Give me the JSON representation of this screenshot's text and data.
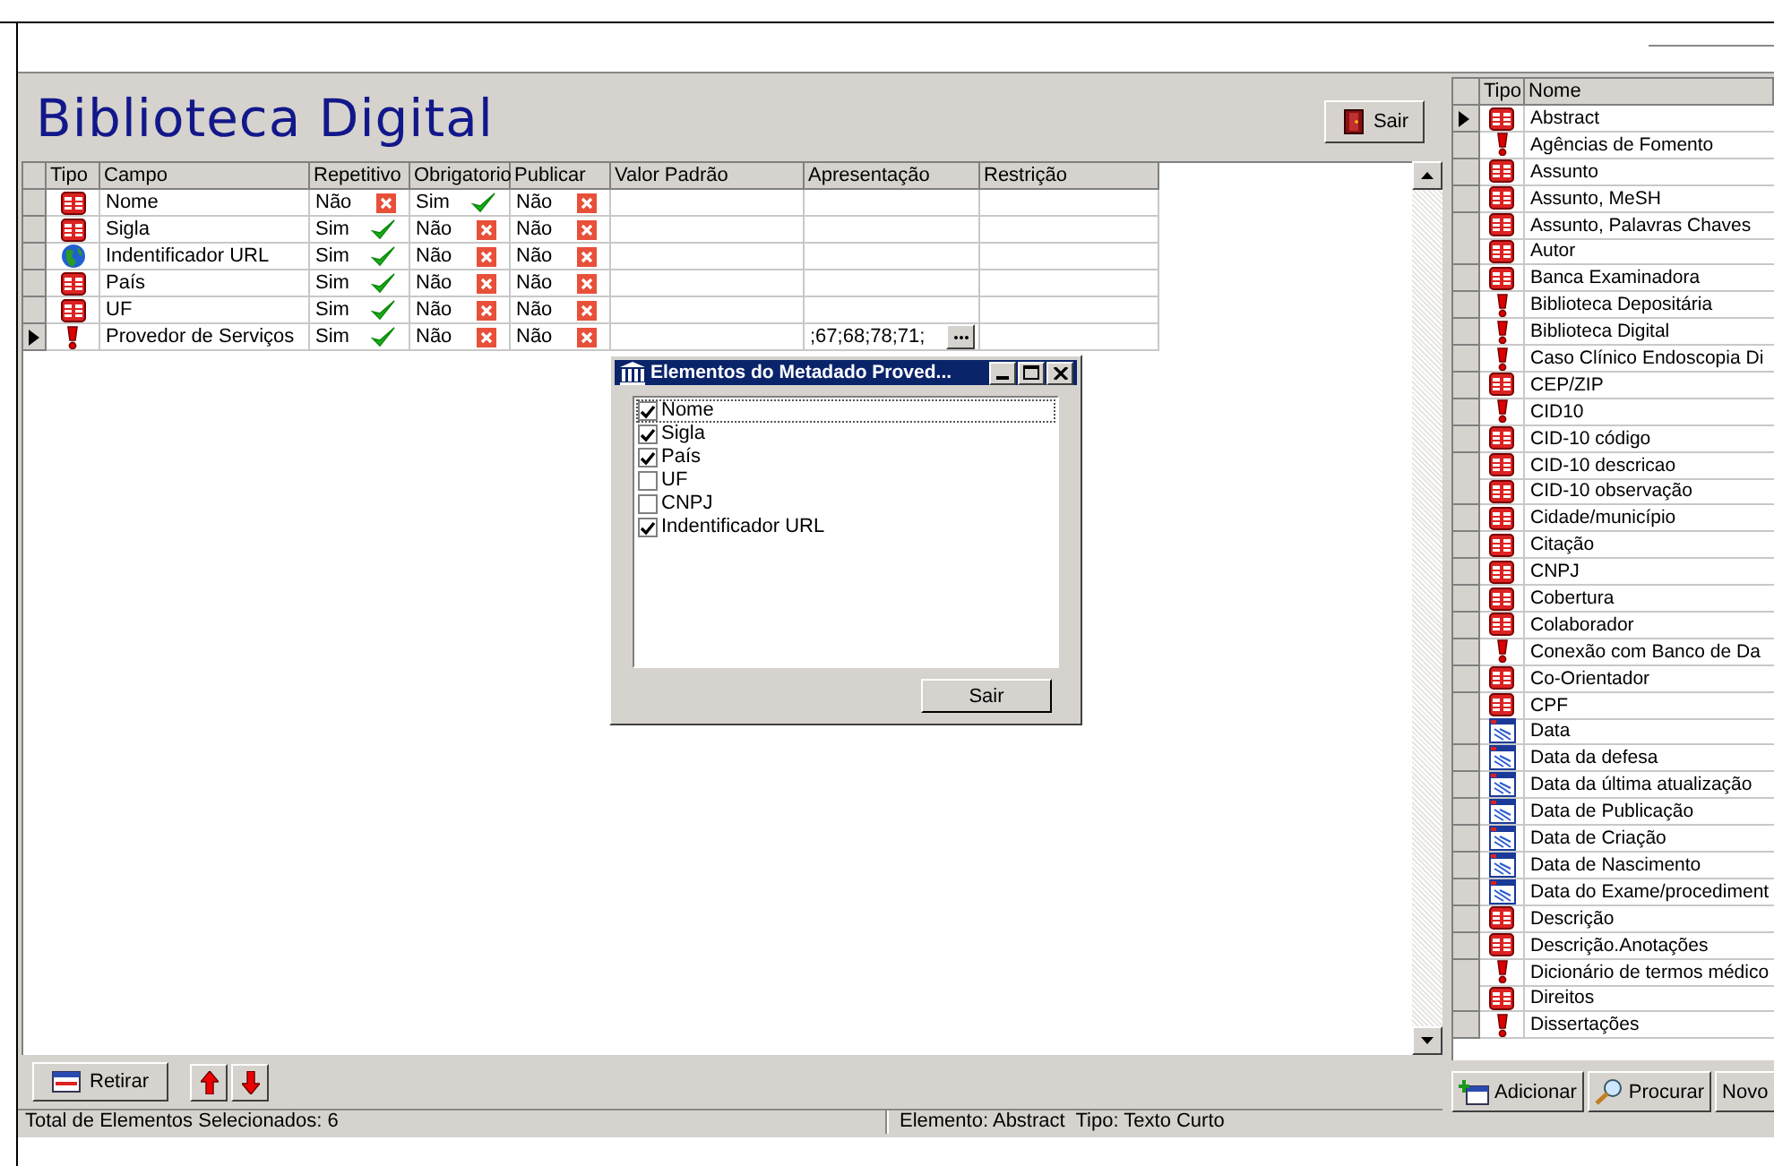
{
  "app": {
    "title": "Biblioteca Digital",
    "exit_button": "Sair"
  },
  "fields_table": {
    "columns": [
      "Tipo",
      "Campo",
      "Repetitivo",
      "Obrigatorio",
      "Publicar",
      "Valor Padrão",
      "Apresentação",
      "Restrição"
    ],
    "rows": [
      {
        "kind": "text",
        "campo": "Nome",
        "repetitivo": {
          "text": "Não",
          "on": false
        },
        "obrigatorio": {
          "text": "Sim",
          "on": true
        },
        "publicar": {
          "text": "Não",
          "on": false
        },
        "apresentacao": "",
        "selected": false
      },
      {
        "kind": "text",
        "campo": "Sigla",
        "repetitivo": {
          "text": "Sim",
          "on": true
        },
        "obrigatorio": {
          "text": "Não",
          "on": false
        },
        "publicar": {
          "text": "Não",
          "on": false
        },
        "apresentacao": "",
        "selected": false
      },
      {
        "kind": "url",
        "campo": "Indentificador URL",
        "repetitivo": {
          "text": "Sim",
          "on": true
        },
        "obrigatorio": {
          "text": "Não",
          "on": false
        },
        "publicar": {
          "text": "Não",
          "on": false
        },
        "apresentacao": "",
        "selected": false
      },
      {
        "kind": "text",
        "campo": "País",
        "repetitivo": {
          "text": "Sim",
          "on": true
        },
        "obrigatorio": {
          "text": "Não",
          "on": false
        },
        "publicar": {
          "text": "Não",
          "on": false
        },
        "apresentacao": "",
        "selected": false
      },
      {
        "kind": "text",
        "campo": "UF",
        "repetitivo": {
          "text": "Sim",
          "on": true
        },
        "obrigatorio": {
          "text": "Não",
          "on": false
        },
        "publicar": {
          "text": "Não",
          "on": false
        },
        "apresentacao": "",
        "selected": false
      },
      {
        "kind": "group",
        "campo": "Provedor de Serviços",
        "repetitivo": {
          "text": "Sim",
          "on": true
        },
        "obrigatorio": {
          "text": "Não",
          "on": false
        },
        "publicar": {
          "text": "Não",
          "on": false
        },
        "apresentacao": ";67;68;78;71;",
        "selected": true
      }
    ]
  },
  "toolbar": {
    "remove_button": "Retirar"
  },
  "status_bar": {
    "left": "Total de Elementos Selecionados: 6",
    "right": "Elemento: Abstract  Tipo: Texto Curto"
  },
  "elements_list": {
    "columns": [
      "Tipo",
      "Nome"
    ],
    "items": [
      {
        "kind": "text",
        "name": "Abstract",
        "selected": true
      },
      {
        "kind": "group",
        "name": "Agências de Fomento",
        "selected": false
      },
      {
        "kind": "text",
        "name": "Assunto",
        "selected": false
      },
      {
        "kind": "text",
        "name": "Assunto, MeSH",
        "selected": false
      },
      {
        "kind": "text",
        "name": "Assunto, Palavras Chaves",
        "selected": false
      },
      {
        "kind": "text",
        "name": "Autor",
        "selected": false
      },
      {
        "kind": "text",
        "name": "Banca Examinadora",
        "selected": false
      },
      {
        "kind": "group",
        "name": "Biblioteca Depositária",
        "selected": false
      },
      {
        "kind": "group",
        "name": "Biblioteca Digital",
        "selected": false
      },
      {
        "kind": "group",
        "name": "Caso Clínico Endoscopia Di",
        "selected": false
      },
      {
        "kind": "text",
        "name": "CEP/ZIP",
        "selected": false
      },
      {
        "kind": "group",
        "name": "CID10",
        "selected": false
      },
      {
        "kind": "text",
        "name": "CID-10 código",
        "selected": false
      },
      {
        "kind": "text",
        "name": "CID-10 descricao",
        "selected": false
      },
      {
        "kind": "text",
        "name": "CID-10 observação",
        "selected": false
      },
      {
        "kind": "text",
        "name": "Cidade/município",
        "selected": false
      },
      {
        "kind": "text",
        "name": "Citação",
        "selected": false
      },
      {
        "kind": "text",
        "name": "CNPJ",
        "selected": false
      },
      {
        "kind": "text",
        "name": "Cobertura",
        "selected": false
      },
      {
        "kind": "text",
        "name": "Colaborador",
        "selected": false
      },
      {
        "kind": "group",
        "name": "Conexão com Banco de Da",
        "selected": false
      },
      {
        "kind": "text",
        "name": "Co-Orientador",
        "selected": false
      },
      {
        "kind": "text",
        "name": "CPF",
        "selected": false
      },
      {
        "kind": "date",
        "name": "Data",
        "selected": false
      },
      {
        "kind": "date",
        "name": "Data da defesa",
        "selected": false
      },
      {
        "kind": "date",
        "name": "Data da última atualização",
        "selected": false
      },
      {
        "kind": "date",
        "name": "Data de  Publicação",
        "selected": false
      },
      {
        "kind": "date",
        "name": "Data de Criação",
        "selected": false
      },
      {
        "kind": "date",
        "name": "Data de Nascimento",
        "selected": false
      },
      {
        "kind": "date",
        "name": "Data do Exame/procediment",
        "selected": false
      },
      {
        "kind": "text",
        "name": "Descrição",
        "selected": false
      },
      {
        "kind": "text",
        "name": "Descrição.Anotações",
        "selected": false
      },
      {
        "kind": "group",
        "name": "Dicionário de termos médico",
        "selected": false
      },
      {
        "kind": "text",
        "name": "Direitos",
        "selected": false
      },
      {
        "kind": "group",
        "name": "Dissertações",
        "selected": false
      }
    ],
    "buttons": [
      "Adicionar",
      "Procurar",
      "Novo"
    ]
  },
  "dialog": {
    "title": "Elementos do Metadado Proved...",
    "items": [
      {
        "label": "Nome",
        "checked": true,
        "focused": true
      },
      {
        "label": "Sigla",
        "checked": true,
        "focused": false
      },
      {
        "label": "País",
        "checked": true,
        "focused": false
      },
      {
        "label": "UF",
        "checked": false,
        "focused": false
      },
      {
        "label": "CNPJ",
        "checked": false,
        "focused": false
      },
      {
        "label": "Indentificador URL",
        "checked": true,
        "focused": false
      }
    ],
    "close_button": "Sair"
  }
}
